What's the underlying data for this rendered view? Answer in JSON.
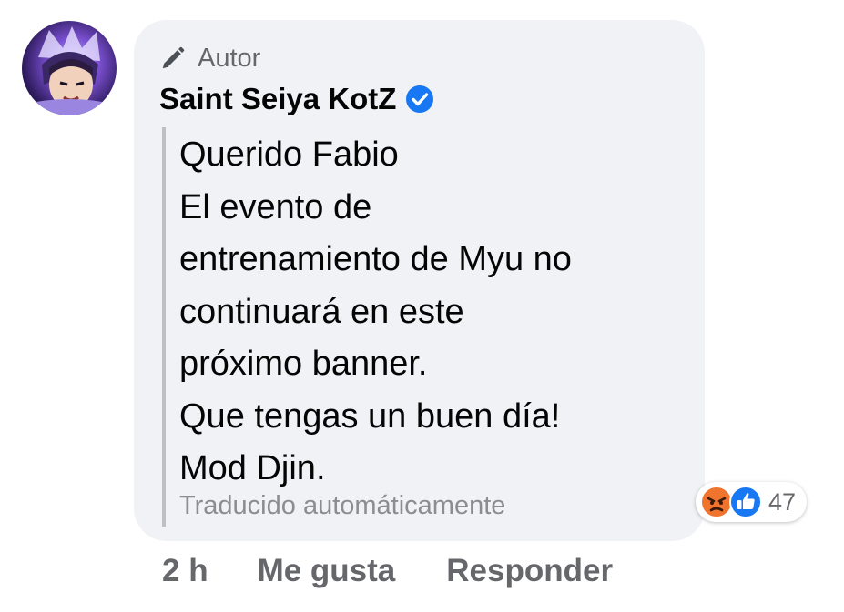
{
  "comment": {
    "author_badge": "Autor",
    "author_badge_icon": "pencil-icon",
    "author_name": "Saint Seiya KotZ",
    "verified_icon": "verified-badge-icon",
    "message_lines": [
      "Querido Fabio",
      "El evento de",
      "entrenamiento de Myu no",
      "continuará en este",
      "próximo banner.",
      "Que tengas un buen día!",
      "Mod Djin."
    ],
    "translation_note": "Traducido automáticamente",
    "reactions": {
      "icons": [
        "angry-reaction-icon",
        "like-reaction-icon"
      ],
      "count": "47"
    },
    "actions": {
      "time": "2 h",
      "like_label": "Me gusta",
      "reply_label": "Responder"
    }
  },
  "colors": {
    "bubble_bg": "#f0f2f5",
    "secondary_text": "#65676b",
    "verified_blue": "#1877f2",
    "angry_orange": "#f0732e"
  }
}
